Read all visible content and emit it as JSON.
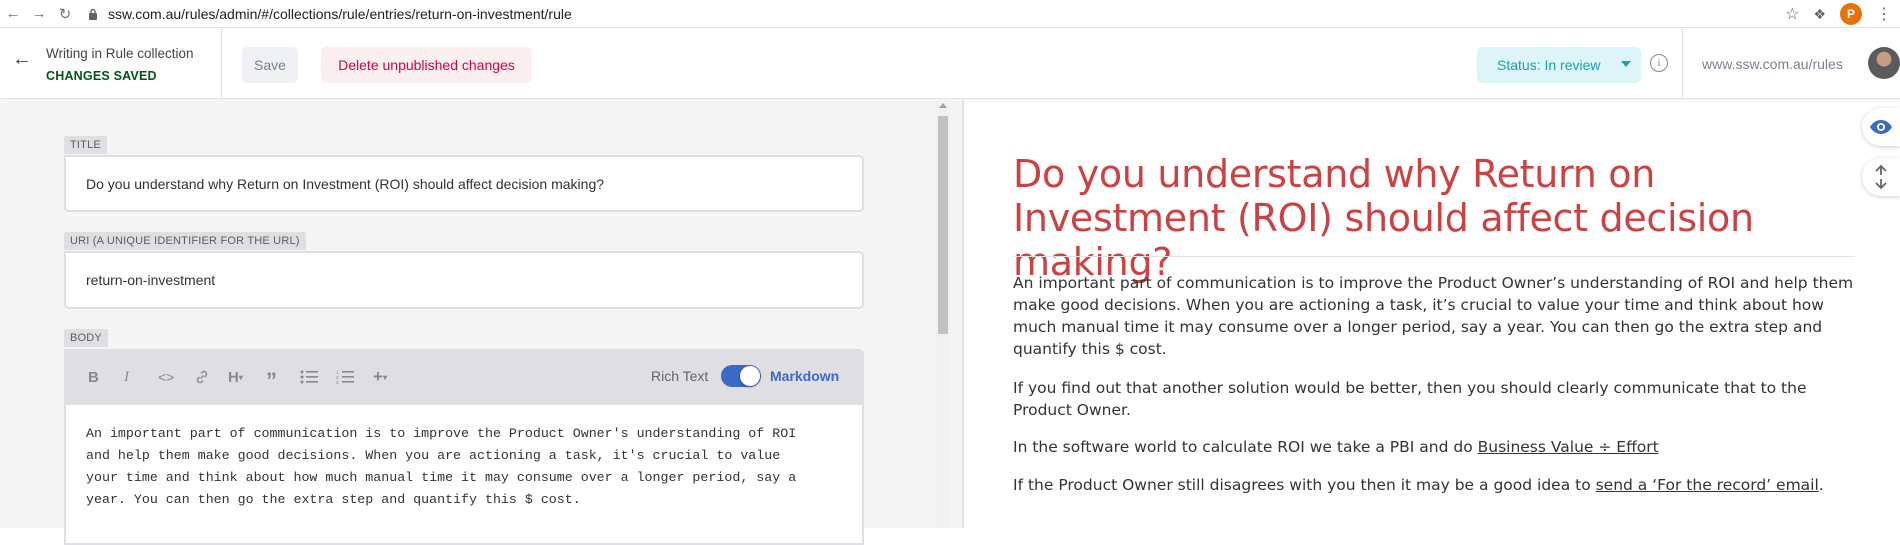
{
  "browser": {
    "url": "ssw.com.au/rules/admin/#/collections/rule/entries/return-on-investment/rule",
    "profile_initial": "P"
  },
  "header": {
    "collection_title": "Writing in Rule collection",
    "save_state": "CHANGES SAVED",
    "save_label": "Save",
    "delete_label": "Delete unpublished changes",
    "status_label": "Status: In review",
    "site_link": "www.ssw.com.au/rules"
  },
  "editor": {
    "title_label": "TITLE",
    "title_value": "Do you understand why Return on Investment (ROI) should affect decision making?",
    "uri_label": "URI (A UNIQUE IDENTIFIER FOR THE URL)",
    "uri_value": "return-on-investment",
    "body_label": "BODY",
    "rich_text_label": "Rich Text",
    "markdown_label": "Markdown",
    "body_lines": [
      "An important part of communication is to improve the Product Owner's understanding of ROI",
      "and help them make good decisions. When you are actioning a task, it's crucial to value",
      "your time and think about how much manual time it may consume over a longer period, say a",
      "year. You can then go the extra step and quantify this $ cost."
    ]
  },
  "preview": {
    "title": "Do you understand why Return on Investment (ROI) should affect decision making?",
    "p1": "An important part of communication is to improve the Product Owner’s understanding of ROI and help them make good decisions. When you are actioning a task, it’s crucial to value your time and think about how much manual time it may consume over a longer period, say a year. You can then go the extra step and quantify this $ cost.",
    "p2": "If you find out that another solution would be better, then you should clearly communicate that to the Product Owner.",
    "p3_text": "In the software world to calculate ROI we take a PBI and do ",
    "p3_link": "Business Value ÷ Effort",
    "p4_text": "If the Product Owner still disagrees with you then it may be a good idea to ",
    "p4_link": "send a ‘For the record’ email",
    "p4_end": "."
  },
  "colors": {
    "title_red": "#cc4141",
    "saved_green": "#005614",
    "delete_red": "#d3004b",
    "status_teal": "#17a2b8",
    "toggle_blue": "#3a69c7"
  }
}
